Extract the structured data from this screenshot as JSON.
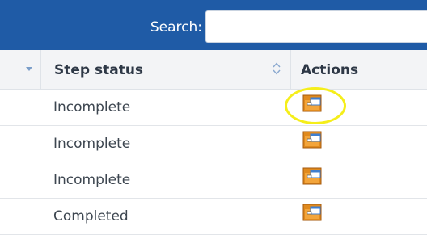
{
  "search": {
    "label": "Search:",
    "value": "",
    "placeholder": ""
  },
  "table": {
    "columns": [
      {
        "key": "toggle",
        "label": ""
      },
      {
        "key": "step_status",
        "label": "Step status"
      },
      {
        "key": "actions",
        "label": "Actions"
      }
    ],
    "rows": [
      {
        "step_status": "Incomplete",
        "action_icon": "folder-form-icon"
      },
      {
        "step_status": "Incomplete",
        "action_icon": "folder-form-icon"
      },
      {
        "step_status": "Incomplete",
        "action_icon": "folder-form-icon"
      },
      {
        "step_status": "Completed",
        "action_icon": "folder-form-icon"
      }
    ]
  },
  "annotation": {
    "type": "highlight-circle",
    "target": "row-1-action",
    "color": "#f5ee1a"
  },
  "colors": {
    "header_bar": "#1f5ba6",
    "highlight": "#f5ee1a",
    "icon_orange": "#e08a1e",
    "icon_blue": "#3f7fd0"
  }
}
